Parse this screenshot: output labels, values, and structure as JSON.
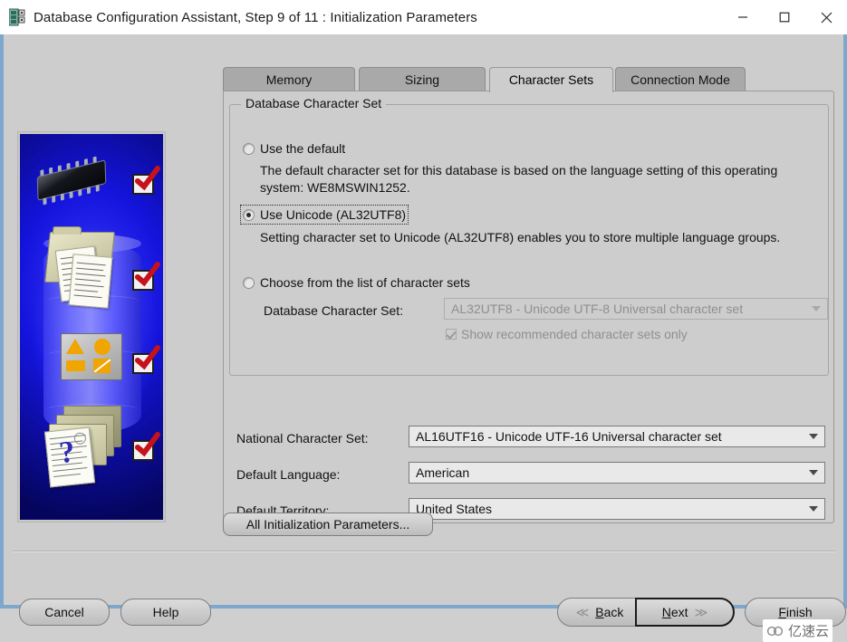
{
  "window": {
    "title": "Database Configuration Assistant, Step 9 of 11 : Initialization Parameters",
    "app_icon": "database-rack-icon",
    "controls": {
      "minimize": "minimize-icon",
      "maximize": "maximize-icon",
      "close": "close-icon"
    }
  },
  "tabs": [
    {
      "label": "Memory",
      "active": false
    },
    {
      "label": "Sizing",
      "active": false
    },
    {
      "label": "Character Sets",
      "active": true
    },
    {
      "label": "Connection Mode",
      "active": false
    }
  ],
  "character_sets": {
    "group_legend": "Database Character Set",
    "options": [
      {
        "id": "use-default",
        "label": "Use the default",
        "selected": false,
        "description": "The default character set for this database is based on the language setting of this operating system: WE8MSWIN1252."
      },
      {
        "id": "use-unicode",
        "label": "Use Unicode (AL32UTF8)",
        "selected": true,
        "focused": true,
        "description": "Setting character set to Unicode (AL32UTF8) enables you to store multiple language groups."
      },
      {
        "id": "choose-from-list",
        "label": "Choose from the list of character sets",
        "selected": false
      }
    ],
    "db_charset": {
      "label": "Database Character Set:",
      "value": "AL32UTF8 - Unicode UTF-8 Universal character set",
      "disabled": true
    },
    "show_recommended": {
      "label": "Show recommended character sets only",
      "checked": true,
      "disabled": true
    }
  },
  "fields": [
    {
      "label": "National Character Set:",
      "value": "AL16UTF16 - Unicode UTF-16 Universal character set"
    },
    {
      "label": "Default Language:",
      "value": "American"
    },
    {
      "label": "Default Territory:",
      "value": "United States"
    }
  ],
  "buttons": {
    "all_params": "All Initialization Parameters...",
    "cancel": "Cancel",
    "help": "Help",
    "back": "Back",
    "next": "Next",
    "finish": "Finish"
  },
  "watermark": {
    "text": "亿速云",
    "icon": "cloud-logo-icon"
  },
  "colors": {
    "window_border": "#7ea7cd",
    "dialog_bg": "#cdcdcd",
    "tab_inactive": "#a9a9a9",
    "sidebar_blue": "#1414dd",
    "check_red": "#c5121b",
    "disabled_text": "#8f8f8f"
  }
}
